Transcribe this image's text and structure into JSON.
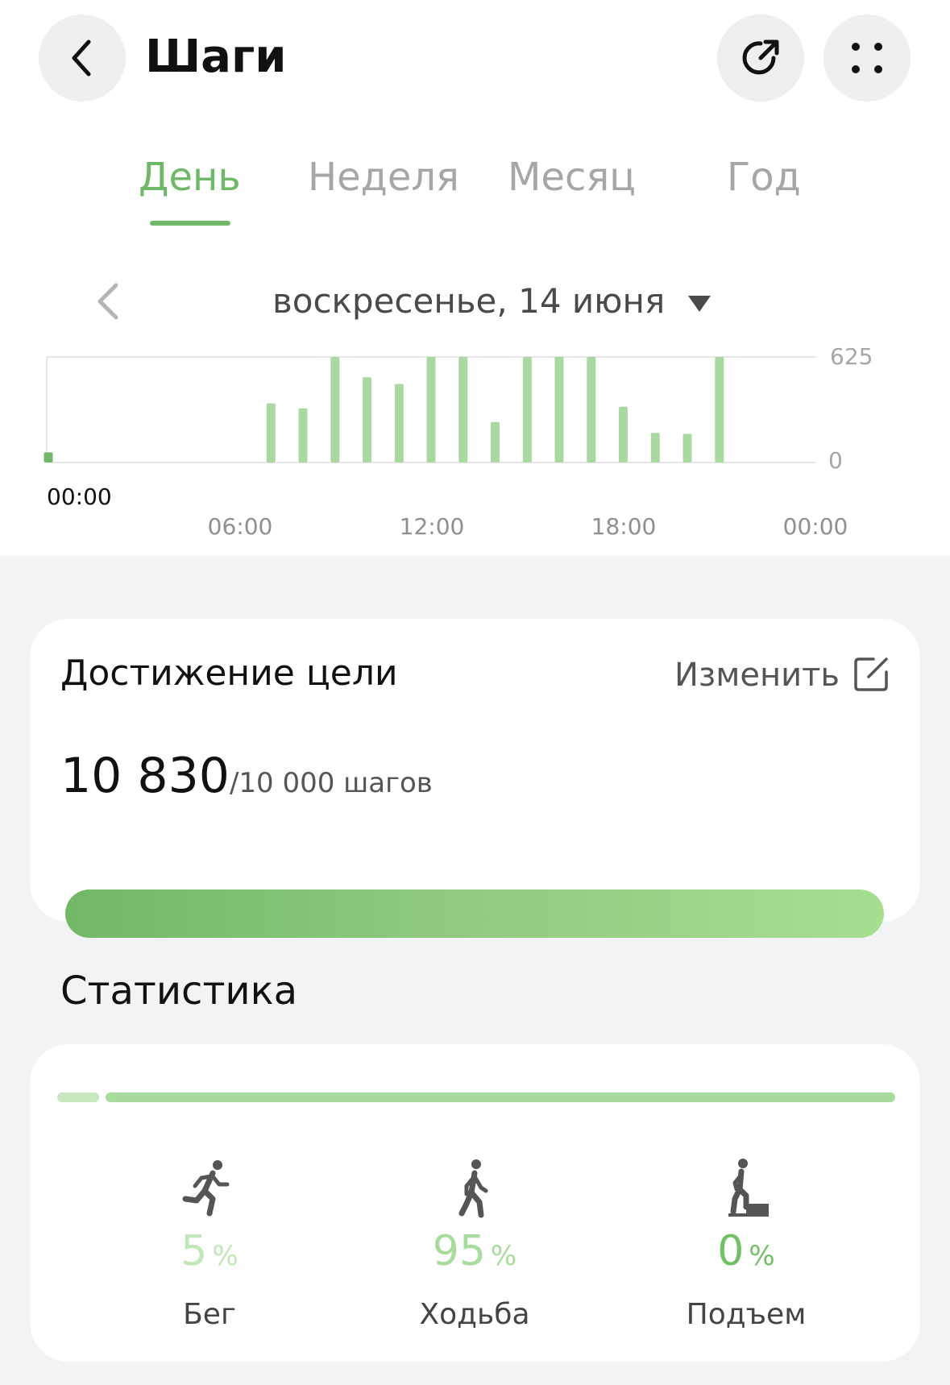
{
  "header": {
    "title": "Шаги"
  },
  "tabs": [
    {
      "label": "День",
      "active": true
    },
    {
      "label": "Неделя",
      "active": false
    },
    {
      "label": "Месяц",
      "active": false
    },
    {
      "label": "Год",
      "active": false
    }
  ],
  "date_selector": {
    "label": "воскресенье, 14 июня"
  },
  "chart_data": {
    "type": "bar",
    "x_tick_labels": [
      "00:00",
      "06:00",
      "12:00",
      "18:00",
      "00:00"
    ],
    "y_tick_labels": [
      "625",
      "0"
    ],
    "ylim": [
      0,
      625
    ],
    "selected_time_label": "00:00",
    "accent_color": "#a9d9a0",
    "selected_color": "#6fb868",
    "bars": [
      {
        "hour": 0.0,
        "value": 60,
        "selected": true
      },
      {
        "hour": 7.0,
        "value": 350
      },
      {
        "hour": 8.0,
        "value": 320
      },
      {
        "hour": 9.0,
        "value": 625
      },
      {
        "hour": 10.0,
        "value": 505
      },
      {
        "hour": 11.0,
        "value": 465
      },
      {
        "hour": 12.0,
        "value": 625
      },
      {
        "hour": 13.0,
        "value": 625
      },
      {
        "hour": 14.0,
        "value": 240
      },
      {
        "hour": 15.0,
        "value": 625
      },
      {
        "hour": 16.0,
        "value": 625
      },
      {
        "hour": 17.0,
        "value": 625
      },
      {
        "hour": 18.0,
        "value": 330
      },
      {
        "hour": 19.0,
        "value": 175
      },
      {
        "hour": 20.0,
        "value": 170
      },
      {
        "hour": 21.0,
        "value": 625
      }
    ]
  },
  "goal_card": {
    "title": "Достижение цели",
    "edit_label": "Изменить",
    "steps_value": "10 830",
    "steps_goal": "/10 000 шагов",
    "progress_fraction": 1.0
  },
  "stats": {
    "title": "Статистика",
    "items": [
      {
        "key": "run",
        "value": "5",
        "unit": "%",
        "label": "Бег",
        "icon": "running-icon",
        "color": "#c2e6b9"
      },
      {
        "key": "walk",
        "value": "95",
        "unit": "%",
        "label": "Ходьба",
        "icon": "walking-icon",
        "color": "#a8dc9c"
      },
      {
        "key": "climb",
        "value": "0",
        "unit": "%",
        "label": "Подъем",
        "icon": "climbing-icon",
        "color": "#72c065"
      }
    ]
  },
  "colors": {
    "accent": "#6fb868",
    "inactive_tab": "#a6a6a6",
    "background": "#f2f3f5"
  }
}
